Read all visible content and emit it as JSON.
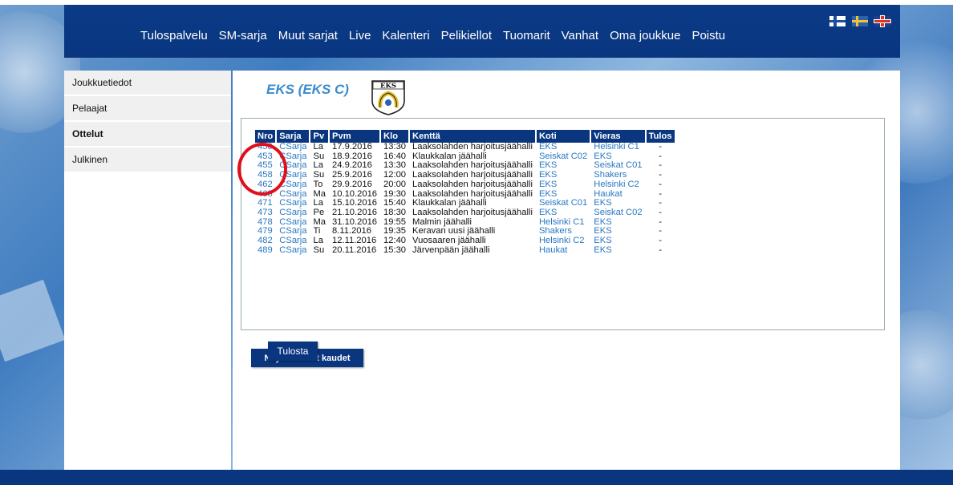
{
  "nav": {
    "items": [
      "Tulospalvelu",
      "SM-sarja",
      "Muut sarjat",
      "Live",
      "Kalenteri",
      "Pelikiellot",
      "Tuomarit",
      "Vanhat",
      "Oma joukkue",
      "Poistu"
    ]
  },
  "sidebar": {
    "items": [
      {
        "label": "Joukkuetiedot",
        "active": false
      },
      {
        "label": "Pelaajat",
        "active": false
      },
      {
        "label": "Ottelut",
        "active": true
      },
      {
        "label": "Julkinen",
        "active": false
      }
    ]
  },
  "team": {
    "title": "EKS (EKS C)",
    "logo_text": "EKS"
  },
  "table": {
    "headers": [
      "Nro",
      "Sarja",
      "Pv",
      "Pvm",
      "Klo",
      "Kenttä",
      "Koti",
      "Vieras",
      "Tulos"
    ],
    "rows": [
      [
        "450",
        "CSarja",
        "La",
        "17.9.2016",
        "13:30",
        "Laaksolahden harjoitusjäähalli",
        "EKS",
        "Helsinki C1",
        "-"
      ],
      [
        "453",
        "CSarja",
        "Su",
        "18.9.2016",
        "16:40",
        "Klaukkalan jäähalli",
        "Seiskat C02",
        "EKS",
        "-"
      ],
      [
        "455",
        "CSarja",
        "La",
        "24.9.2016",
        "13:30",
        "Laaksolahden harjoitusjäähalli",
        "EKS",
        "Seiskat C01",
        "-"
      ],
      [
        "458",
        "CSarja",
        "Su",
        "25.9.2016",
        "12:00",
        "Laaksolahden harjoitusjäähalli",
        "EKS",
        "Shakers",
        "-"
      ],
      [
        "462",
        "CSarja",
        "To",
        "29.9.2016",
        "20:00",
        "Laaksolahden harjoitusjäähalli",
        "EKS",
        "Helsinki C2",
        "-"
      ],
      [
        "468",
        "CSarja",
        "Ma",
        "10.10.2016",
        "19:30",
        "Laaksolahden harjoitusjäähalli",
        "EKS",
        "Haukat",
        "-"
      ],
      [
        "471",
        "CSarja",
        "La",
        "15.10.2016",
        "15:40",
        "Klaukkalan jäähalli",
        "Seiskat C01",
        "EKS",
        "-"
      ],
      [
        "473",
        "CSarja",
        "Pe",
        "21.10.2016",
        "18:30",
        "Laaksolahden harjoitusjäähalli",
        "EKS",
        "Seiskat C02",
        "-"
      ],
      [
        "478",
        "CSarja",
        "Ma",
        "31.10.2016",
        "19:55",
        "Malmin jäähalli",
        "Helsinki C1",
        "EKS",
        "-"
      ],
      [
        "479",
        "CSarja",
        "Ti",
        "8.11.2016",
        "19:35",
        "Keravan uusi jäähalli",
        "Shakers",
        "EKS",
        "-"
      ],
      [
        "482",
        "CSarja",
        "La",
        "12.11.2016",
        "12:40",
        "Vuosaaren jäähalli",
        "Helsinki C2",
        "EKS",
        "-"
      ],
      [
        "489",
        "CSarja",
        "Su",
        "20.11.2016",
        "15:30",
        "Järvenpään jäähalli",
        "Haukat",
        "EKS",
        "-"
      ]
    ]
  },
  "buttons": {
    "old_seasons": "Näytä vanhat kaudet",
    "print": "Tulosta"
  },
  "colors": {
    "navy": "#0a3680",
    "link": "#2a78c2",
    "title": "#3a8ccf",
    "annotation": "#e0101a"
  }
}
